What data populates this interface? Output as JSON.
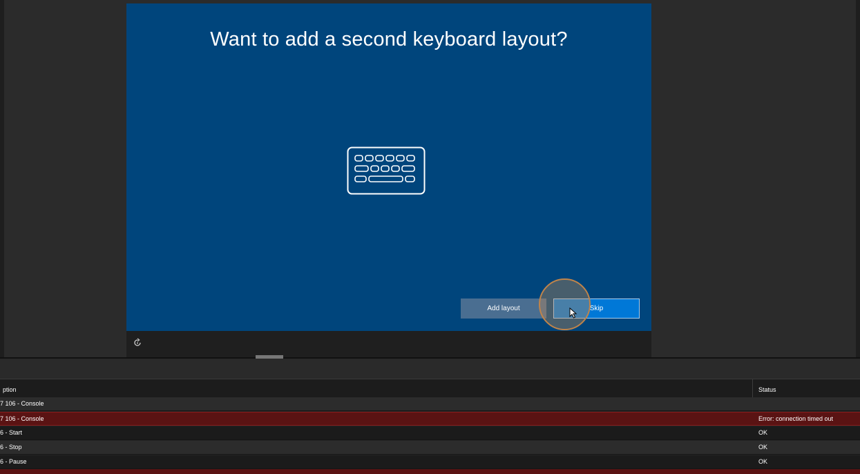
{
  "vm": {
    "title": "Want to add a second keyboard layout?",
    "add_layout_label": "Add layout",
    "skip_label": "Skip"
  },
  "grid": {
    "columns": {
      "description": "ption",
      "status": "Status"
    },
    "rows": [
      {
        "description": "7 106 - Console",
        "status": "",
        "state": "normal"
      },
      {
        "description": "7 106 - Console",
        "status": "Error: connection timed out",
        "state": "error"
      },
      {
        "description": "6 - Start",
        "status": "OK",
        "state": "normal"
      },
      {
        "description": "6 - Stop",
        "status": "OK",
        "state": "normal"
      },
      {
        "description": "6 - Pause",
        "status": "OK",
        "state": "normal"
      }
    ]
  },
  "icons": {
    "keyboard": "keyboard-icon",
    "ease_of_access": "ease-of-access-icon",
    "cursor": "mouse-cursor-icon"
  },
  "colors": {
    "vm_background": "#00457c",
    "skip_button": "#0078d7",
    "add_layout_button": "#4a6e91",
    "error_row": "#5a1313",
    "highlight": "#c0844a"
  }
}
